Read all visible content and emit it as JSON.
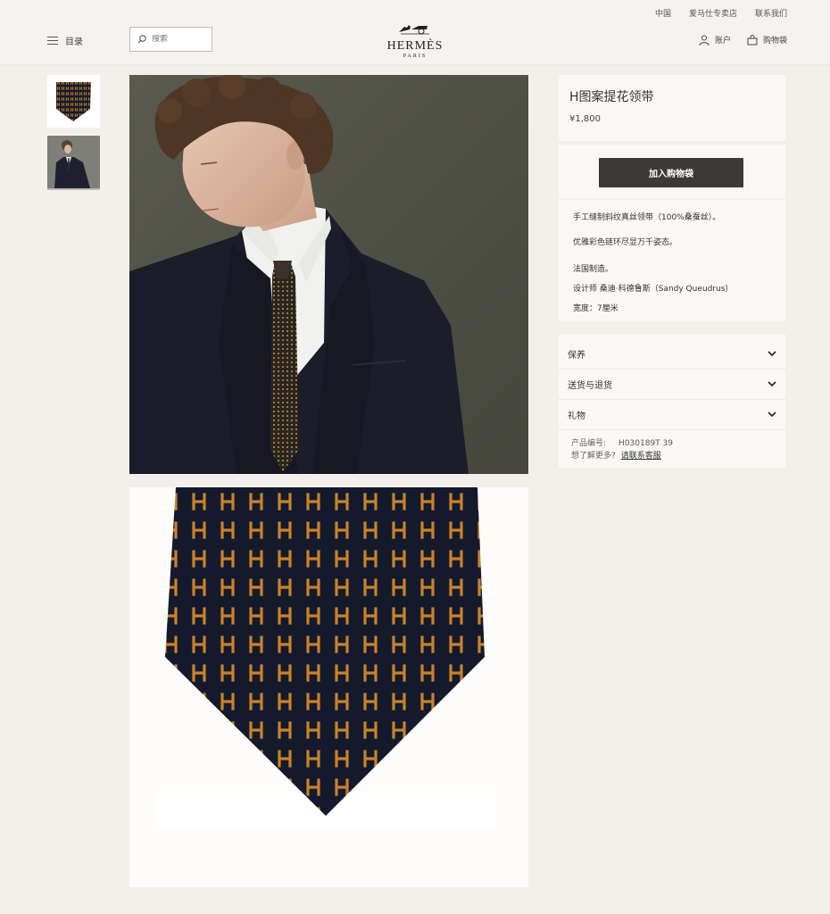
{
  "header": {
    "top_links": [
      "中国",
      "爱马仕专卖店",
      "联系我们"
    ],
    "menu_label": "目录",
    "search_placeholder": "搜索",
    "logo_brand": "HERMÈS",
    "logo_city": "PARIS",
    "account_label": "账户",
    "bag_label": "购物袋"
  },
  "product": {
    "title": "H图案提花领带",
    "price": "¥1,800",
    "add_to_bag": "加入购物袋",
    "description": [
      "手工缝制斜纹真丝领带（100%桑蚕丝）。",
      "优雅彩色链环尽显万千姿态。",
      "法国制造。",
      "设计师 桑迪·科德鲁斯（Sandy Queudrus）",
      "宽度：7厘米"
    ],
    "accordions": [
      "保养",
      "送货与退货",
      "礼物"
    ],
    "sku_label": "产品编号:",
    "sku_value": "H030189T 39",
    "more_label": "想了解更多?",
    "more_link": "请联系客服"
  },
  "colors": {
    "button_dark": "#3c3a37",
    "background": "#f3f0eb",
    "tie_navy": "#141a2c",
    "tie_orange": "#c9822a"
  },
  "icons": [
    "menu-icon",
    "search-icon",
    "horse-carriage-logo",
    "user-icon",
    "bag-icon",
    "chevron-down-icon"
  ]
}
